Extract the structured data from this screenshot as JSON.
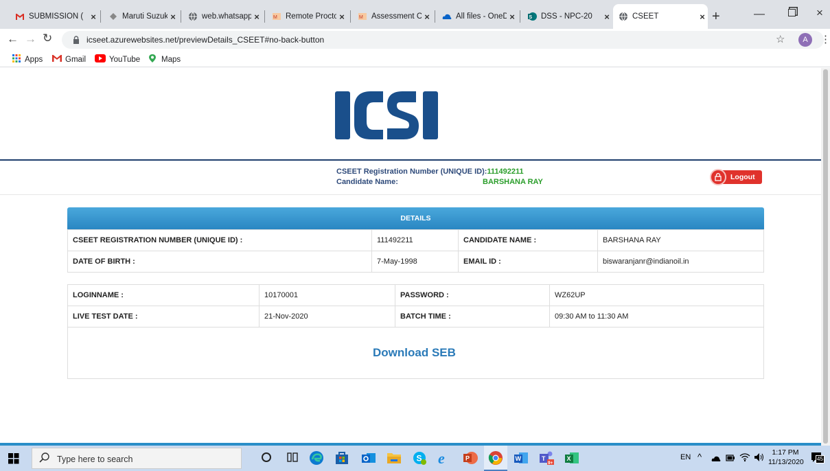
{
  "browser": {
    "tabs": [
      {
        "label": "SUBMISSION (",
        "icon": "gmail-icon"
      },
      {
        "label": "Maruti Suzuki",
        "icon": "maruti-icon"
      },
      {
        "label": "web.whatsapp.",
        "icon": "globe-icon"
      },
      {
        "label": "Remote Procto",
        "icon": "proctor-icon"
      },
      {
        "label": "Assessment Ce",
        "icon": "proctor-icon"
      },
      {
        "label": "All files - OneD",
        "icon": "onedrive-icon"
      },
      {
        "label": "DSS - NPC-20",
        "icon": "sharepoint-icon"
      },
      {
        "label": "CSEET",
        "icon": "globe-icon"
      }
    ],
    "url": "icseet.azurewebsites.net/previewDetails_CSEET#no-back-button",
    "profile_initial": "A",
    "bookmarks": [
      "Apps",
      "Gmail",
      "YouTube",
      "Maps"
    ]
  },
  "site": {
    "logo_text": "ICSI",
    "header": {
      "reg_label": "CSEET Registration Number (UNIQUE ID):",
      "reg_value": "111492211",
      "name_label": "Candidate Name:",
      "name_value": "BARSHANA RAY",
      "logout_label": "Logout"
    },
    "details_title": "DETAILS",
    "details": {
      "reg_label": "CSEET REGISTRATION NUMBER (UNIQUE ID) :",
      "reg_value": "111492211",
      "cand_label": "CANDIDATE NAME :",
      "cand_value": "BARSHANA RAY",
      "dob_label": "DATE OF BIRTH :",
      "dob_value": "7-May-1998",
      "email_label": "EMAIL ID :",
      "email_value": "biswaranjanr@indianoil.in"
    },
    "login": {
      "login_label": "LOGINNAME :",
      "login_value": "10170001",
      "pass_label": "PASSWORD :",
      "pass_value": "WZ62UP",
      "date_label": "LIVE TEST DATE :",
      "date_value": "21-Nov-2020",
      "batch_label": "BATCH TIME :",
      "batch_value": "09:30 AM to 11:30 AM",
      "download_label": "Download SEB"
    }
  },
  "taskbar": {
    "search_placeholder": "Type here to search",
    "lang": "EN",
    "time": "1:17 PM",
    "date": "11/13/2020",
    "notif_count": "45"
  },
  "colors": {
    "accent": "#2a8ec8",
    "logo_blue": "#1a4f8b",
    "value_green": "#2a9d2a",
    "logout_red": "#e0322c"
  }
}
